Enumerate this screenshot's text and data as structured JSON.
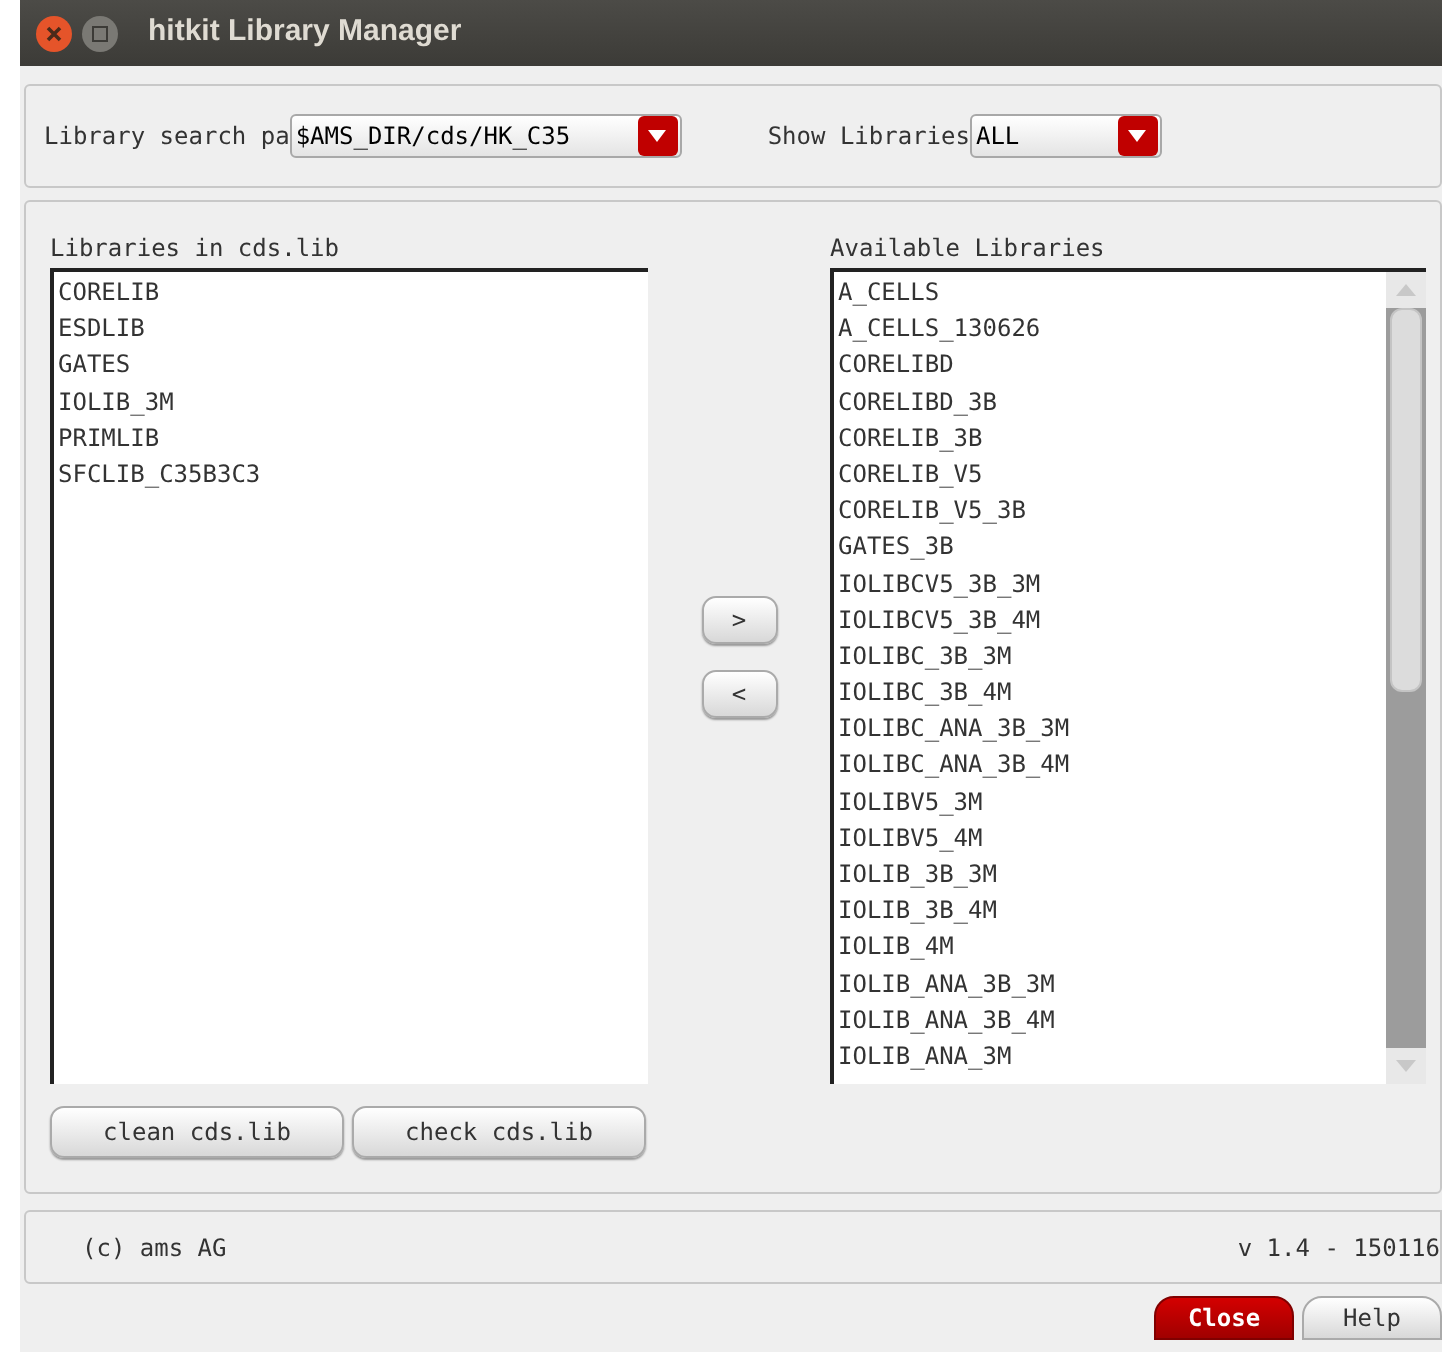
{
  "window": {
    "title": "hitkit Library Manager"
  },
  "search_path": {
    "label": "Library search pa",
    "value": "$AMS_DIR/cds/HK_C35"
  },
  "show_libraries": {
    "label": "Show Libraries",
    "value": "ALL"
  },
  "cds_libraries": {
    "title": "Libraries in cds.lib",
    "items": [
      "CORELIB",
      "ESDLIB",
      "GATES",
      "IOLIB_3M",
      "PRIMLIB",
      "SFCLIB_C35B3C3"
    ]
  },
  "transfer_buttons": [
    ">",
    "<"
  ],
  "available_libraries": {
    "title": "Available Libraries",
    "items": [
      "A_CELLS",
      "A_CELLS_130626",
      "CORELIBD",
      "CORELIBD_3B",
      "CORELIB_3B",
      "CORELIB_V5",
      "CORELIB_V5_3B",
      "GATES_3B",
      "IOLIBCV5_3B_3M",
      "IOLIBCV5_3B_4M",
      "IOLIBC_3B_3M",
      "IOLIBC_3B_4M",
      "IOLIBC_ANA_3B_3M",
      "IOLIBC_ANA_3B_4M",
      "IOLIBV5_3M",
      "IOLIBV5_4M",
      "IOLIB_3B_3M",
      "IOLIB_3B_4M",
      "IOLIB_4M",
      "IOLIB_ANA_3B_3M",
      "IOLIB_ANA_3B_4M",
      "IOLIB_ANA_3M"
    ]
  },
  "list_buttons": [
    "clean cds.lib",
    "check cds.lib"
  ],
  "status_bar": {
    "copyright": "(c) ams AG",
    "version": "v 1.4 - 150116"
  },
  "dialog_buttons": [
    {
      "label": "Close",
      "kind": "primary"
    },
    {
      "label": "Help",
      "kind": "normal"
    }
  ]
}
